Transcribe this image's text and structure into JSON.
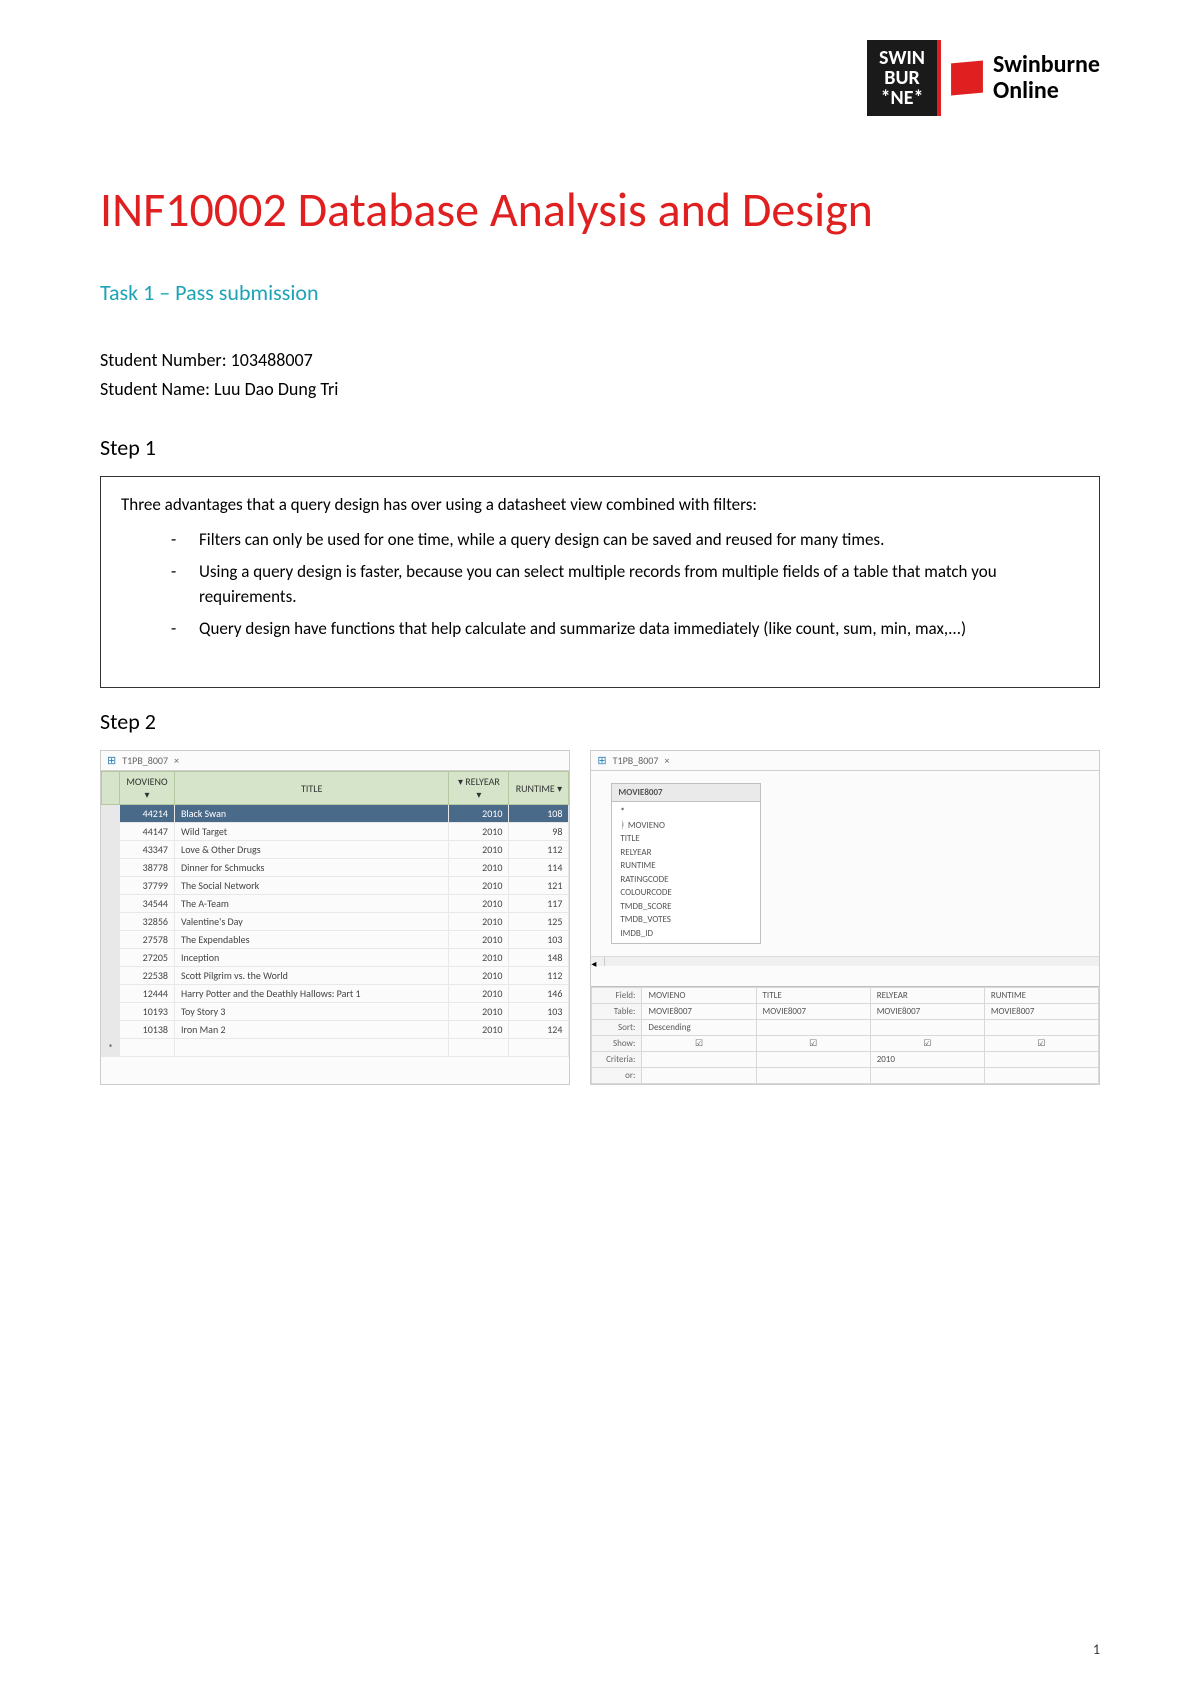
{
  "logo": {
    "swin_line1": "SWIN",
    "swin_line2": "BUR",
    "swin_line3": "*NE*",
    "online_line1": "Swinburne",
    "online_line2": "Online"
  },
  "title": "INF10002 Database Analysis and Design",
  "subtitle": "Task 1 – Pass submission",
  "student_number_label": "Student Number: 103488007",
  "student_name_label": "Student Name: Luu Dao Dung Tri",
  "step1": {
    "heading": "Step 1",
    "intro": "Three advantages that a query design has over using a datasheet view combined with filters:",
    "bullets": [
      "Filters can only be used for one time, while a query design can be saved and reused for many times.",
      "Using a query design is faster, because you can select multiple records from multiple fields of a table that match you requirements.",
      "Query design have functions that help calculate and summarize data immediately (like count, sum, min, max,...)"
    ]
  },
  "step2": {
    "heading": "Step 2",
    "tab_name": "T1PB_8007",
    "tab_close": "×",
    "datasheet": {
      "columns": [
        "MOVIENO",
        "TITLE",
        "RELYEAR",
        "RUNTIME"
      ],
      "rows": [
        {
          "movieno": "44214",
          "title": "Black Swan",
          "relyear": "2010",
          "runtime": "108"
        },
        {
          "movieno": "44147",
          "title": "Wild Target",
          "relyear": "2010",
          "runtime": "98"
        },
        {
          "movieno": "43347",
          "title": "Love & Other Drugs",
          "relyear": "2010",
          "runtime": "112"
        },
        {
          "movieno": "38778",
          "title": "Dinner for Schmucks",
          "relyear": "2010",
          "runtime": "114"
        },
        {
          "movieno": "37799",
          "title": "The Social Network",
          "relyear": "2010",
          "runtime": "121"
        },
        {
          "movieno": "34544",
          "title": "The A-Team",
          "relyear": "2010",
          "runtime": "117"
        },
        {
          "movieno": "32856",
          "title": "Valentine's Day",
          "relyear": "2010",
          "runtime": "125"
        },
        {
          "movieno": "27578",
          "title": "The Expendables",
          "relyear": "2010",
          "runtime": "103"
        },
        {
          "movieno": "27205",
          "title": "Inception",
          "relyear": "2010",
          "runtime": "148"
        },
        {
          "movieno": "22538",
          "title": "Scott Pilgrim vs. the World",
          "relyear": "2010",
          "runtime": "112"
        },
        {
          "movieno": "12444",
          "title": "Harry Potter and the Deathly Hallows: Part 1",
          "relyear": "2010",
          "runtime": "146"
        },
        {
          "movieno": "10193",
          "title": "Toy Story 3",
          "relyear": "2010",
          "runtime": "103"
        },
        {
          "movieno": "10138",
          "title": "Iron Man 2",
          "relyear": "2010",
          "runtime": "124"
        }
      ],
      "new_row_marker": "*"
    },
    "design": {
      "table_name": "MOVIE8007",
      "fields": [
        "*",
        "MOVIENO",
        "TITLE",
        "RELYEAR",
        "RUNTIME",
        "RATINGCODE",
        "COLOURCODE",
        "TMDB_SCORE",
        "TMDB_VOTES",
        "IMDB_ID"
      ],
      "grid_labels": {
        "field": "Field:",
        "table": "Table:",
        "sort": "Sort:",
        "show": "Show:",
        "criteria": "Criteria:",
        "or": "or:"
      },
      "grid_cols": [
        {
          "field": "MOVIENO",
          "table": "MOVIE8007",
          "sort": "Descending",
          "show": true,
          "criteria": ""
        },
        {
          "field": "TITLE",
          "table": "MOVIE8007",
          "sort": "",
          "show": true,
          "criteria": ""
        },
        {
          "field": "RELYEAR",
          "table": "MOVIE8007",
          "sort": "",
          "show": true,
          "criteria": "2010"
        },
        {
          "field": "RUNTIME",
          "table": "MOVIE8007",
          "sort": "",
          "show": true,
          "criteria": ""
        }
      ]
    }
  },
  "page_number": "1",
  "key_icon": "ᛓ",
  "check_glyph": "☑"
}
